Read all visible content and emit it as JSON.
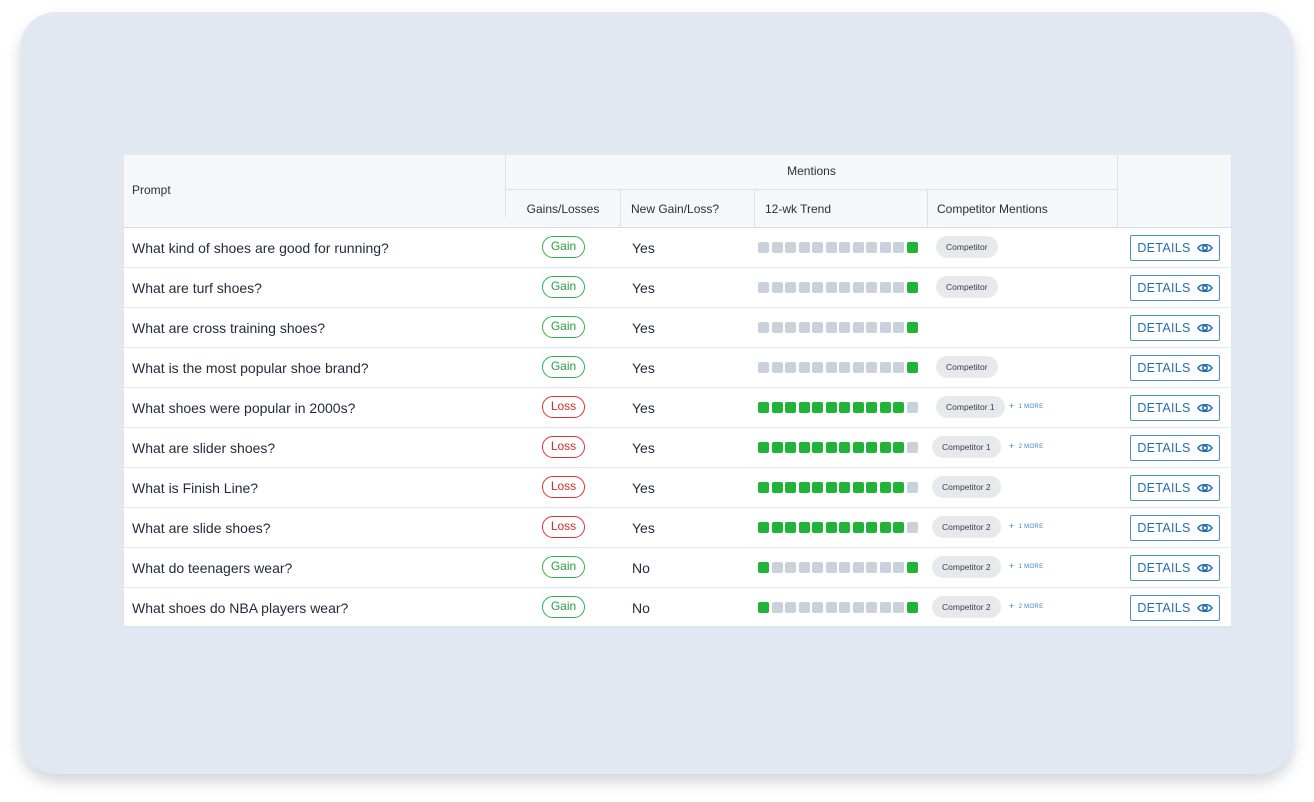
{
  "header": {
    "prompt": "Prompt",
    "mentions": "Mentions",
    "gains_losses": "Gains/Losses",
    "new_gain_loss": "New Gain/Loss?",
    "trend": "12-wk Trend",
    "competitor_mentions": "Competitor Mentions"
  },
  "colors": {
    "gain": "#22a13f",
    "loss": "#d42b29",
    "trend_on": "#1fb437",
    "trend_off": "#c9d1da",
    "link": "#1f6db5"
  },
  "details_label": "DETAILS",
  "rows": [
    {
      "prompt": "What kind of shoes are good for running?",
      "status": "Gain",
      "new": "Yes",
      "trend": [
        0,
        0,
        0,
        0,
        0,
        0,
        0,
        0,
        0,
        0,
        0,
        1
      ],
      "competitor": "Competitor",
      "more": ""
    },
    {
      "prompt": "What are turf shoes?",
      "status": "Gain",
      "new": "Yes",
      "trend": [
        0,
        0,
        0,
        0,
        0,
        0,
        0,
        0,
        0,
        0,
        0,
        1
      ],
      "competitor": "Competitor",
      "more": ""
    },
    {
      "prompt": "What are cross training shoes?",
      "status": "Gain",
      "new": "Yes",
      "trend": [
        0,
        0,
        0,
        0,
        0,
        0,
        0,
        0,
        0,
        0,
        0,
        1
      ],
      "competitor": "",
      "more": ""
    },
    {
      "prompt": "What is the most popular shoe brand?",
      "status": "Gain",
      "new": "Yes",
      "trend": [
        0,
        0,
        0,
        0,
        0,
        0,
        0,
        0,
        0,
        0,
        0,
        1
      ],
      "competitor": "Competitor",
      "more": ""
    },
    {
      "prompt": "What shoes were popular in 2000s?",
      "status": "Loss",
      "new": "Yes",
      "trend": [
        1,
        1,
        1,
        1,
        1,
        1,
        1,
        1,
        1,
        1,
        1,
        0
      ],
      "competitor": "Competitor 1",
      "more": "1 MORE"
    },
    {
      "prompt": "What are slider shoes?",
      "status": "Loss",
      "new": "Yes",
      "trend": [
        1,
        1,
        1,
        1,
        1,
        1,
        1,
        1,
        1,
        1,
        1,
        0
      ],
      "competitor": "Competitor 1",
      "more": "2 MORE"
    },
    {
      "prompt": "What is Finish Line?",
      "status": "Loss",
      "new": "Yes",
      "trend": [
        1,
        1,
        1,
        1,
        1,
        1,
        1,
        1,
        1,
        1,
        1,
        0
      ],
      "competitor": "Competitor 2",
      "more": ""
    },
    {
      "prompt": "What are slide shoes?",
      "status": "Loss",
      "new": "Yes",
      "trend": [
        1,
        1,
        1,
        1,
        1,
        1,
        1,
        1,
        1,
        1,
        1,
        0
      ],
      "competitor": "Competitor 2",
      "more": "1 MORE"
    },
    {
      "prompt": "What do teenagers wear?",
      "status": "Gain",
      "new": "No",
      "trend": [
        1,
        0,
        0,
        0,
        0,
        0,
        0,
        0,
        0,
        0,
        0,
        1
      ],
      "competitor": "Competitor 2",
      "more": "1 MORE"
    },
    {
      "prompt": "What shoes do NBA players wear?",
      "status": "Gain",
      "new": "No",
      "trend": [
        1,
        0,
        0,
        0,
        0,
        0,
        0,
        0,
        0,
        0,
        0,
        1
      ],
      "competitor": "Competitor 2",
      "more": "2 MORE"
    }
  ]
}
